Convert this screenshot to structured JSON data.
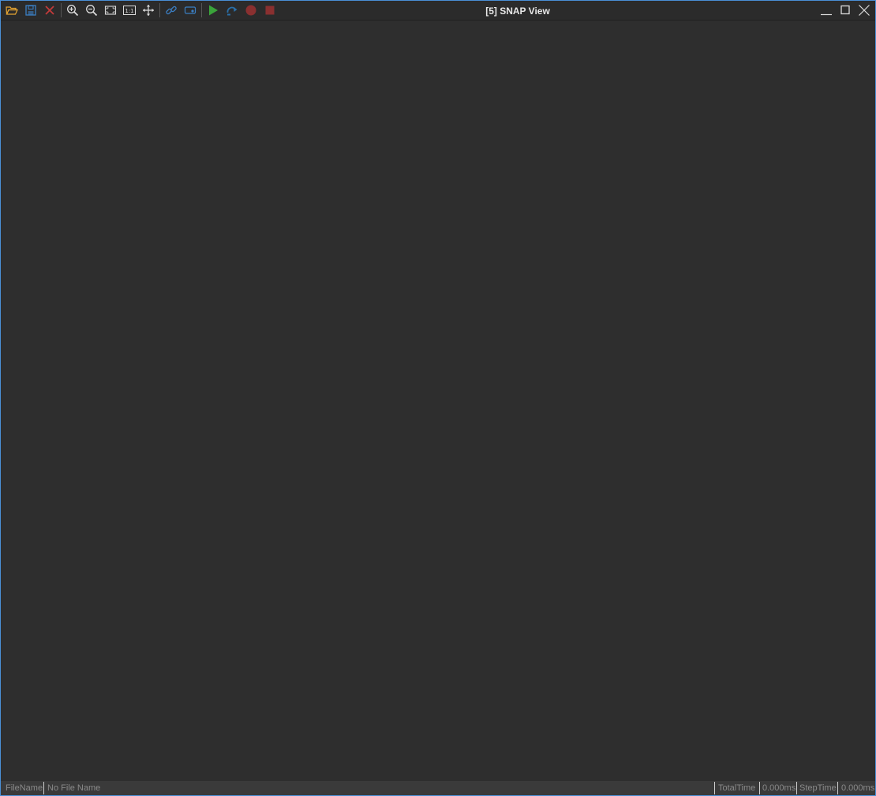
{
  "window": {
    "title": "[5] SNAP View",
    "accent_color": "#4a8fd6",
    "background_color": "#2e2e2e"
  },
  "toolbar": {
    "buttons": [
      {
        "icon": "open-folder-icon",
        "color": "#e6a532"
      },
      {
        "icon": "save-icon",
        "color": "#3b7fc4"
      },
      {
        "icon": "close-icon",
        "color": "#c23b3b"
      },
      {
        "icon": "zoom-in-icon",
        "color": "#dcdcdc"
      },
      {
        "icon": "zoom-out-icon",
        "color": "#dcdcdc"
      },
      {
        "icon": "fit-to-window-icon",
        "color": "#dcdcdc"
      },
      {
        "icon": "actual-size-icon",
        "label": "1:1",
        "color": "#dcdcdc"
      },
      {
        "icon": "pan-icon",
        "color": "#dcdcdc"
      },
      {
        "icon": "link-icon",
        "color": "#3b7fc4"
      },
      {
        "icon": "camera-icon",
        "color": "#3b7fc4"
      },
      {
        "icon": "play-icon",
        "color": "#3aa33a"
      },
      {
        "icon": "step-icon",
        "color": "#2a6fa8"
      },
      {
        "icon": "record-icon",
        "color": "#8a3030"
      },
      {
        "icon": "stop-icon",
        "color": "#8a3030"
      }
    ]
  },
  "statusbar": {
    "filename_label": "FileName",
    "filename_value": "No File Name",
    "total_time_label": "TotalTime",
    "total_time_value": "0.000ms",
    "step_time_label": "StepTime",
    "step_time_value": "0.000ms"
  }
}
